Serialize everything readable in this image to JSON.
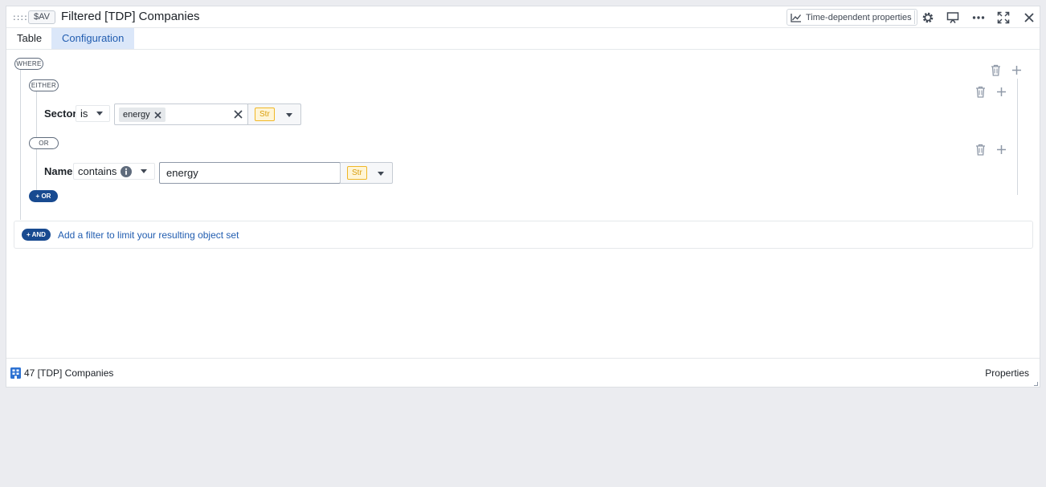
{
  "header": {
    "variable_badge": "$AV",
    "title": "Filtered [TDP] Companies",
    "time_dependent_label": "Time-dependent properties"
  },
  "tabs": [
    {
      "label": "Table",
      "active": false
    },
    {
      "label": "Configuration",
      "active": true
    }
  ],
  "filter": {
    "where_label": "WHERE",
    "either_label": "EITHER",
    "or_label": "OR",
    "add_or_label": "+ OR",
    "conditions": [
      {
        "property": "Sector",
        "operator": "is",
        "value_tag": "energy",
        "type_badge": "Str"
      },
      {
        "property": "Name",
        "operator": "contains",
        "value": "energy",
        "type_badge": "Str"
      }
    ],
    "add_and_label": "+ AND",
    "add_filter_hint": "Add a filter to limit your resulting object set"
  },
  "footer": {
    "count_label": "47 [TDP] Companies",
    "properties_label": "Properties"
  },
  "colors": {
    "accent": "#215db0",
    "dark_button": "#184a90",
    "str_badge": "#f0b726"
  },
  "icons": [
    "drag-handle-icon",
    "chart-line-icon",
    "gear-icon",
    "presentation-icon",
    "more-icon",
    "maximize-icon",
    "close-icon",
    "trash-icon",
    "plus-icon",
    "chevron-down-icon",
    "info-icon",
    "object-type-icon"
  ]
}
